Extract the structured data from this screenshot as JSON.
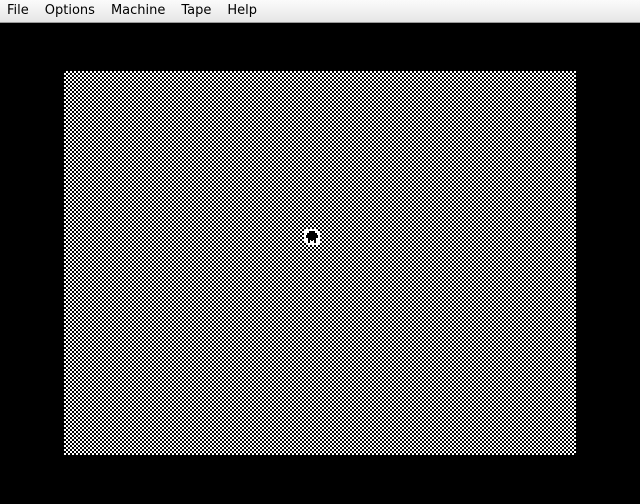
{
  "menubar": {
    "items": [
      {
        "label": "File"
      },
      {
        "label": "Options"
      },
      {
        "label": "Machine"
      },
      {
        "label": "Tape"
      },
      {
        "label": "Help"
      }
    ]
  },
  "screen": {
    "border_color": "#000000",
    "paper_pattern": "checkerboard-black-white",
    "sprite_icon": "block-character-sprite"
  }
}
